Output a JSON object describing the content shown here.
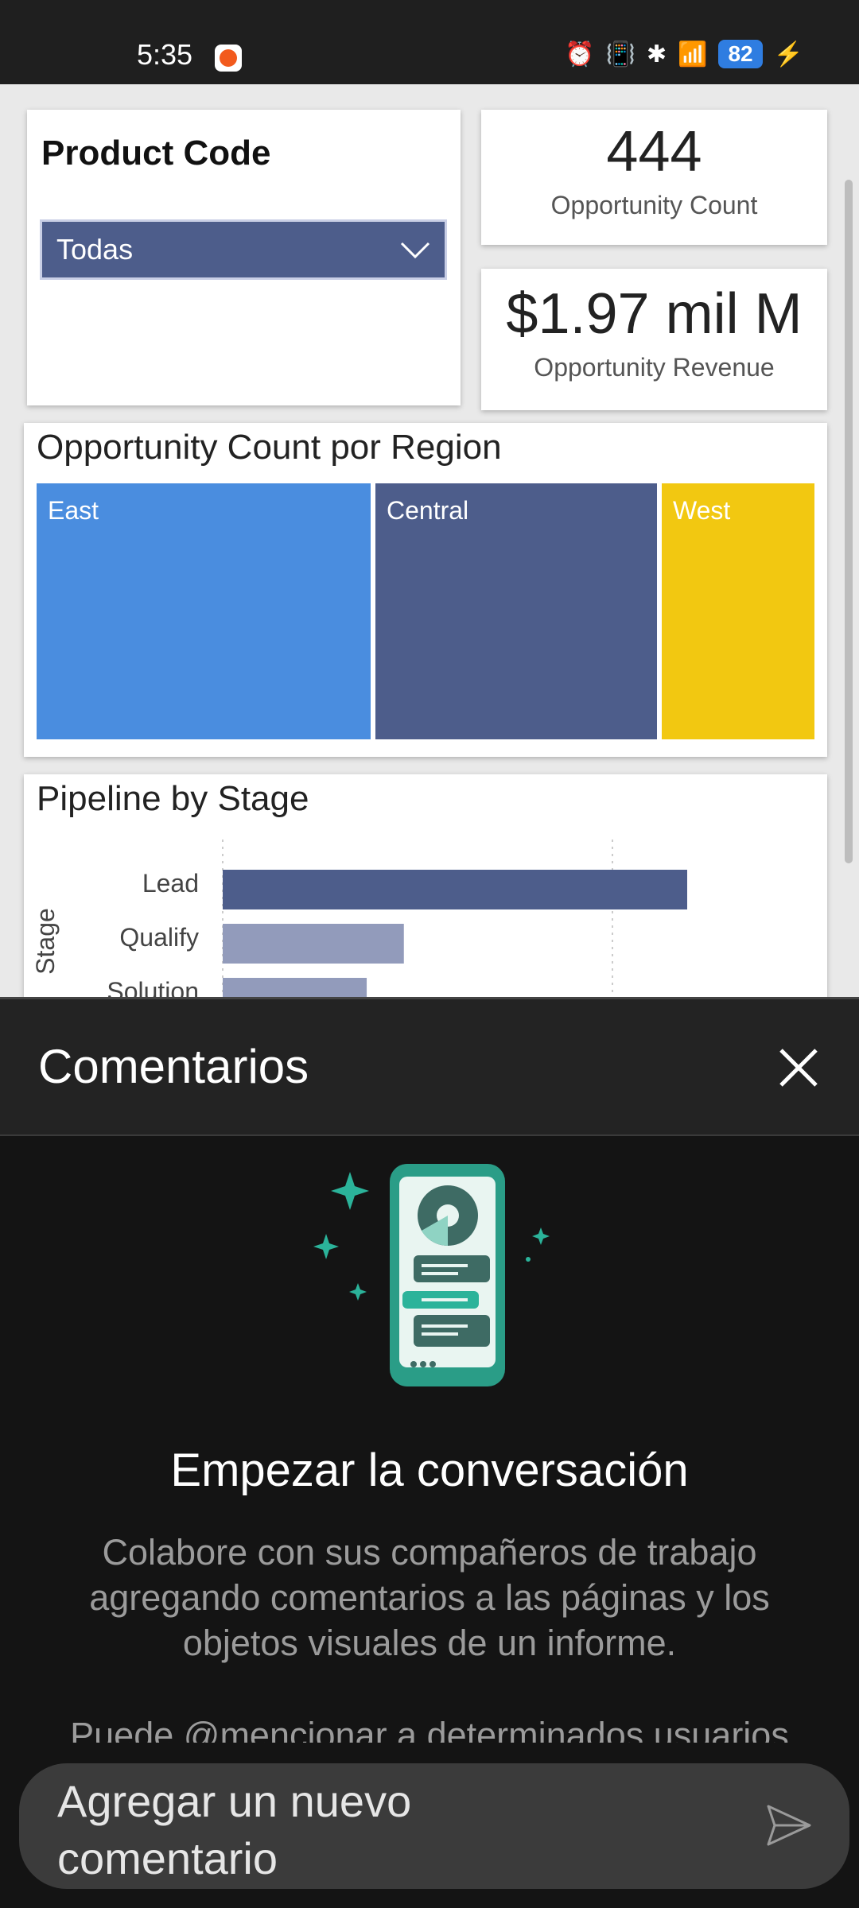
{
  "status_bar": {
    "time": "5:35",
    "battery": "82"
  },
  "report": {
    "slicer": {
      "title": "Product Code",
      "selected": "Todas"
    },
    "kpi_count": {
      "value": "444",
      "label": "Opportunity Count"
    },
    "kpi_revenue": {
      "value": "$1.97 mil M",
      "label": "Opportunity Revenue"
    },
    "treemap": {
      "title": "Opportunity Count por Region",
      "regions": [
        {
          "name": "East",
          "color": "#4a8ddf"
        },
        {
          "name": "Central",
          "color": "#4d5d8b"
        },
        {
          "name": "West",
          "color": "#f2c811"
        }
      ]
    },
    "pipeline": {
      "title": "Pipeline by Stage",
      "axis_label": "Stage"
    }
  },
  "chart_data": {
    "type": "bar",
    "title": "Pipeline by Stage",
    "ylabel": "Stage",
    "categories": [
      "Lead",
      "Qualify",
      "Solution"
    ],
    "values": [
      100,
      39,
      31
    ],
    "colors": [
      "#4d5d8b",
      "#929bbb",
      "#929bbb"
    ]
  },
  "comments": {
    "title": "Comentarios",
    "heading": "Empezar la conversación",
    "description": "Colabore con sus compañeros de trabajo agregando comentarios a las páginas y los objetos visuales de un informe.",
    "description_partial": "Puede @mencionar a determinados usuarios",
    "input_placeholder": "Agregar un nuevo comentario"
  }
}
